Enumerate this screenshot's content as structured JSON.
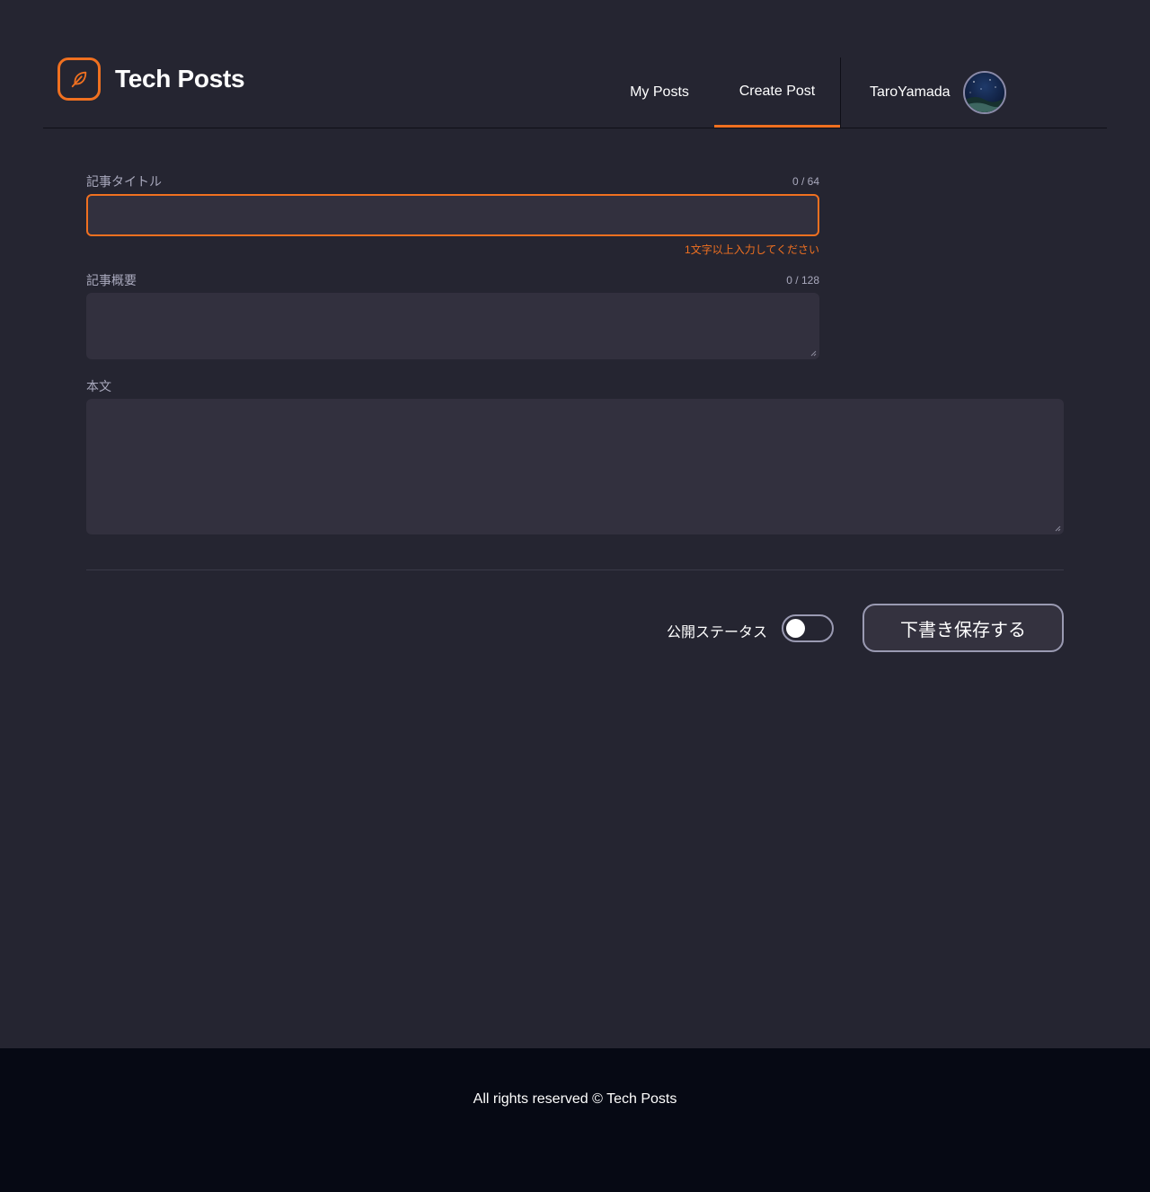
{
  "brand": {
    "name": "Tech Posts",
    "icon": "feather-icon",
    "accent_color": "#f07020"
  },
  "nav": {
    "items": [
      {
        "label": "My Posts",
        "active": false
      },
      {
        "label": "Create Post",
        "active": true
      }
    ],
    "user": {
      "name": "TaroYamada",
      "avatar": "avatar-night-sky"
    }
  },
  "form": {
    "title": {
      "label": "記事タイトル",
      "counter": "0 / 64",
      "value": "",
      "error": "1文字以上入力してください"
    },
    "summary": {
      "label": "記事概要",
      "counter": "0 / 128",
      "value": ""
    },
    "body": {
      "label": "本文",
      "value": ""
    },
    "publish_status": {
      "label": "公開ステータス",
      "on": false
    },
    "save_button": "下書き保存する"
  },
  "footer": {
    "text": "All rights reserved © Tech Posts"
  }
}
